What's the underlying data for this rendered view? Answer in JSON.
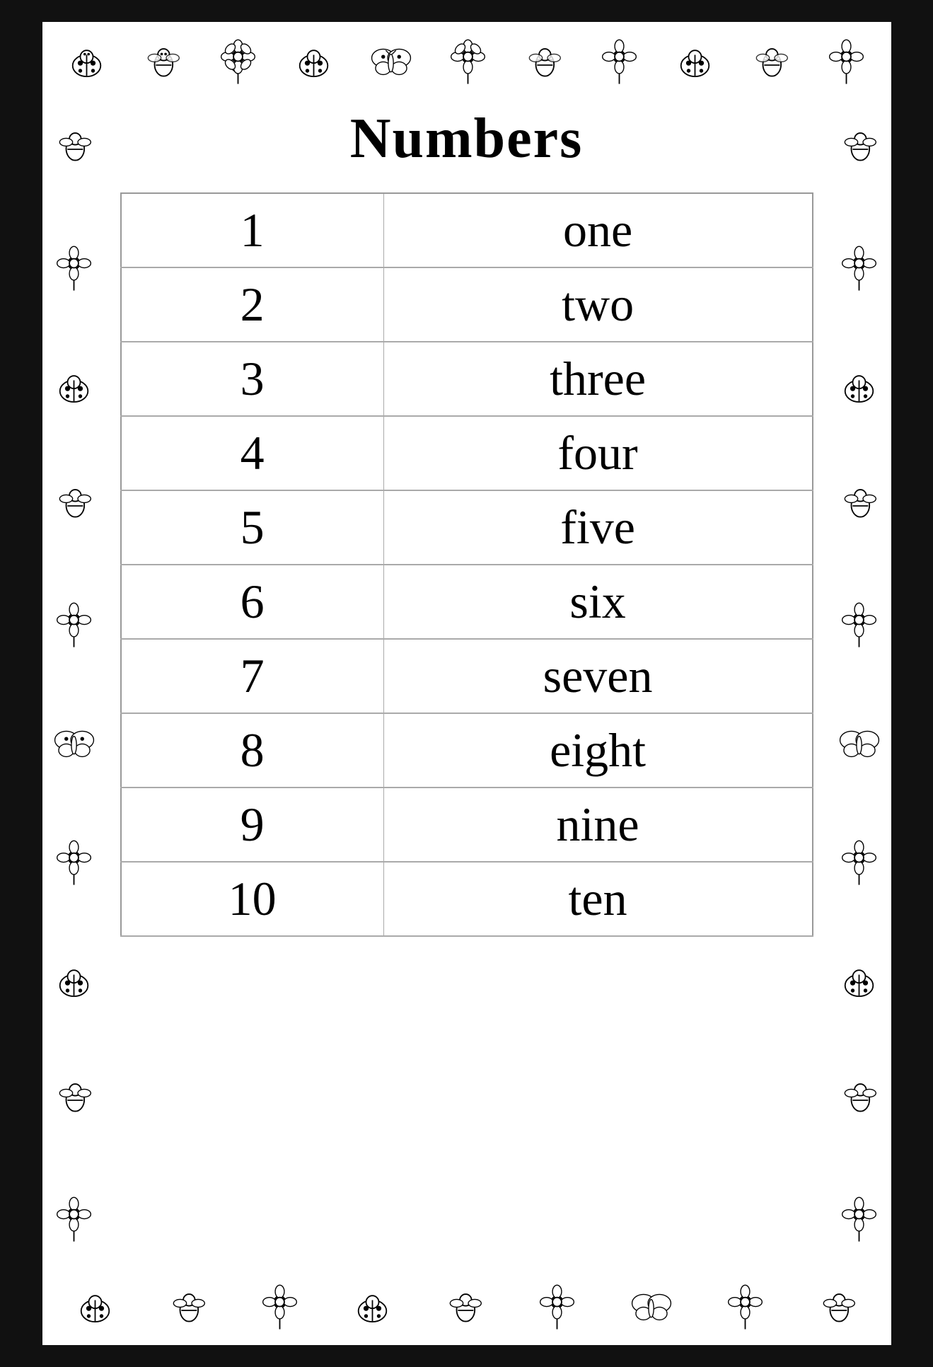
{
  "title": "Numbers",
  "table": {
    "rows": [
      {
        "numeral": "1",
        "word": "one"
      },
      {
        "numeral": "2",
        "word": "two"
      },
      {
        "numeral": "3",
        "word": "three"
      },
      {
        "numeral": "4",
        "word": "four"
      },
      {
        "numeral": "5",
        "word": "five"
      },
      {
        "numeral": "6",
        "word": "six"
      },
      {
        "numeral": "7",
        "word": "seven"
      },
      {
        "numeral": "8",
        "word": "eight"
      },
      {
        "numeral": "9",
        "word": "nine"
      },
      {
        "numeral": "10",
        "word": "ten"
      }
    ]
  }
}
